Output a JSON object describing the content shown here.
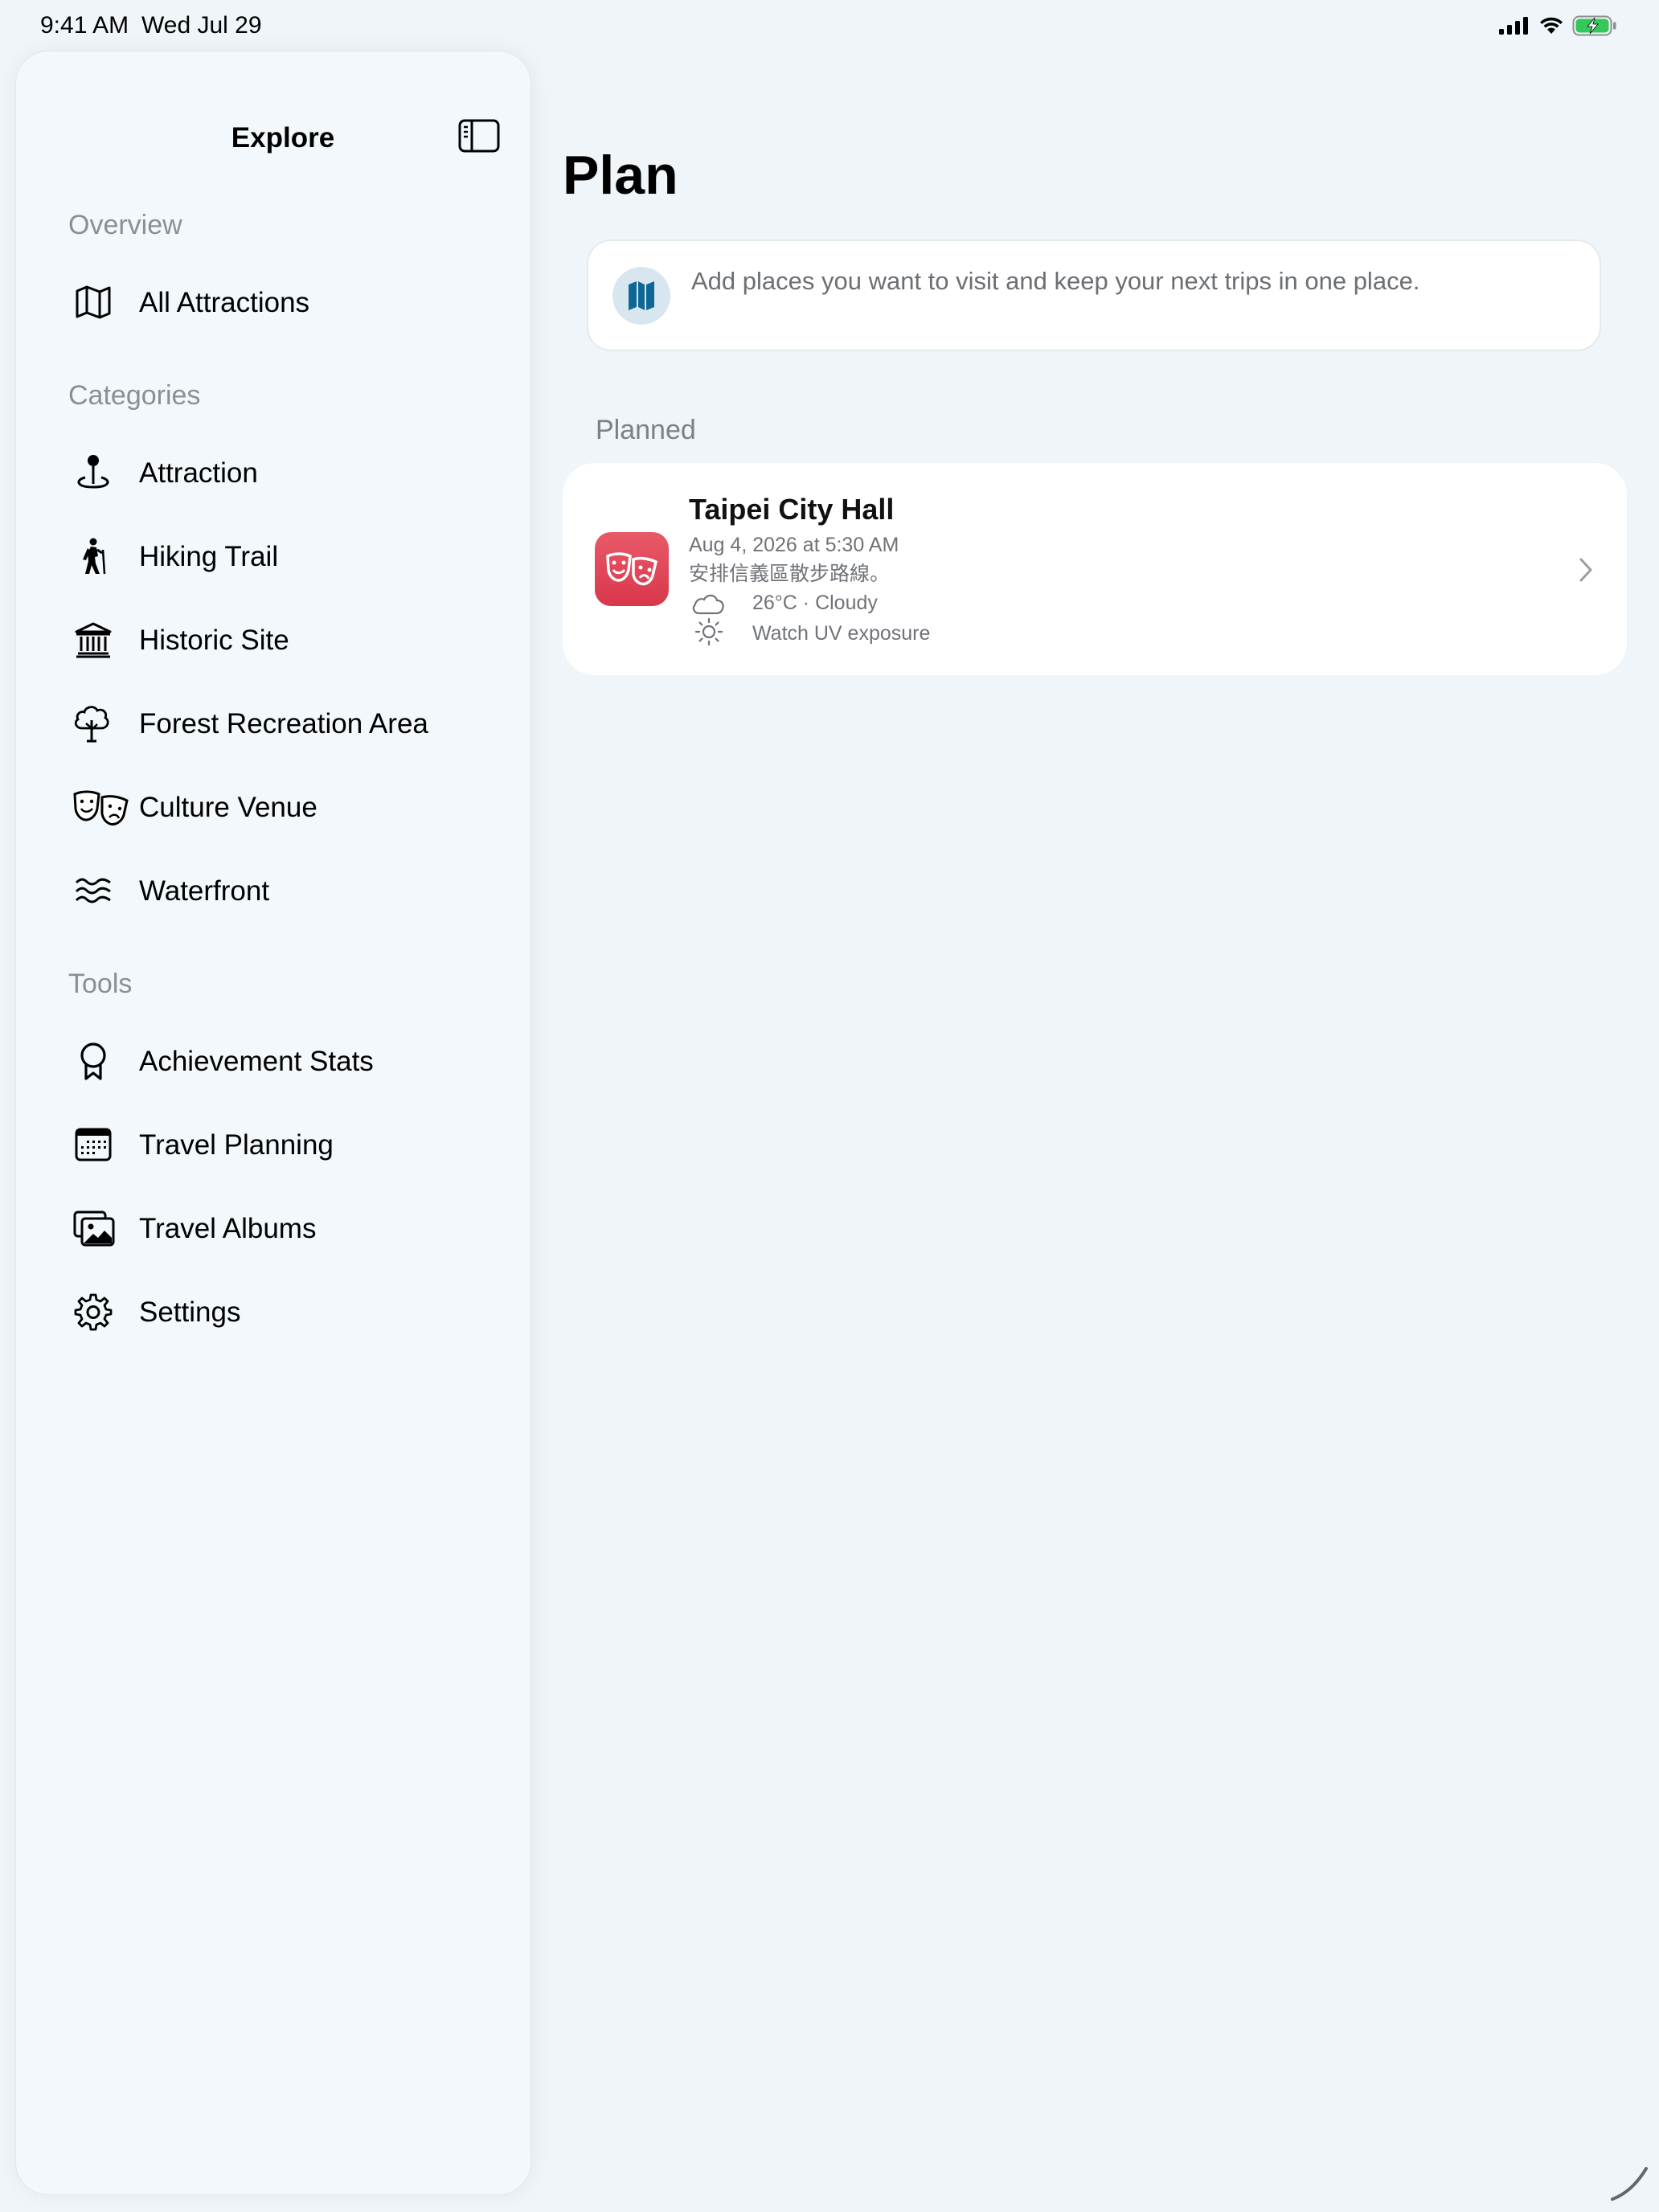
{
  "status_bar": {
    "time": "9:41 AM",
    "date": "Wed Jul 29",
    "icons": [
      "cellular-icon",
      "wifi-icon",
      "battery-charging-icon"
    ],
    "battery_color": "#34c759"
  },
  "sidebar": {
    "title": "Explore",
    "toggle_icon": "sidebar-toggle-icon",
    "sections": {
      "overview": {
        "header": "Overview",
        "items": [
          {
            "label": "All Attractions",
            "icon": "map-icon"
          }
        ]
      },
      "categories": {
        "header": "Categories",
        "items": [
          {
            "label": "Attraction",
            "icon": "map-pin-icon"
          },
          {
            "label": "Hiking Trail",
            "icon": "hiker-icon"
          },
          {
            "label": "Historic Site",
            "icon": "building-columns-icon"
          },
          {
            "label": "Forest Recreation Area",
            "icon": "tree-icon"
          },
          {
            "label": "Culture Venue",
            "icon": "theater-masks-icon"
          },
          {
            "label": "Waterfront",
            "icon": "water-waves-icon"
          }
        ]
      },
      "tools": {
        "header": "Tools",
        "items": [
          {
            "label": "Achievement Stats",
            "icon": "ribbon-award-icon"
          },
          {
            "label": "Travel Planning",
            "icon": "calendar-icon"
          },
          {
            "label": "Travel Albums",
            "icon": "photos-icon"
          },
          {
            "label": "Settings",
            "icon": "gear-icon"
          }
        ]
      }
    }
  },
  "main": {
    "title": "Plan",
    "info_card": {
      "icon": "map-icon",
      "text": "Add places you want to visit and keep your next trips in one place.",
      "icon_color": "#0f6796"
    },
    "planned_section": {
      "header": "Planned",
      "trips": [
        {
          "title": "Taipei City Hall",
          "date": "Aug 4, 2026 at 5:30 AM",
          "note": "安排信義區散步路線。",
          "weather": "26°C · Cloudy",
          "uv": "Watch UV exposure",
          "app_icon": "theater-masks-icon",
          "app_icon_color": "#e04556",
          "weather_icon": "cloud-icon",
          "uv_icon": "sun-icon"
        }
      ]
    }
  }
}
